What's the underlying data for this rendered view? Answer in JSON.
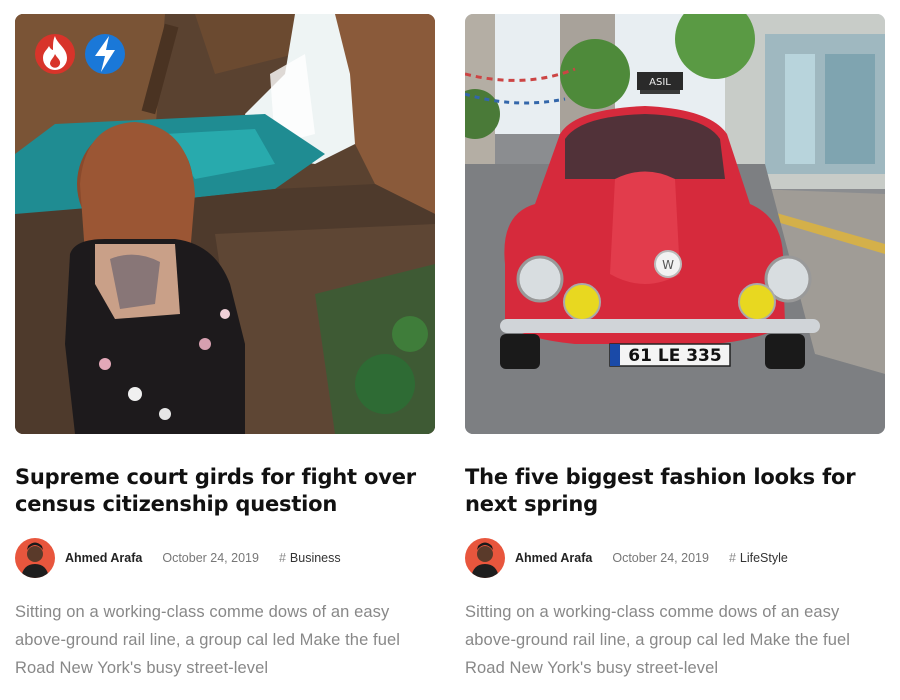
{
  "posts": [
    {
      "title": "Supreme court girds for fight over census citizenship question",
      "author": "Ahmed Arafa",
      "date": "October 24, 2019",
      "category": "Business",
      "excerpt": "Sitting on a working-class comme dows of an easy above-ground rail line, a group cal led Make the fuel Road New York's busy street-level",
      "badges": [
        "fire-icon",
        "lightning-icon"
      ]
    },
    {
      "title": "The five biggest fashion looks for next spring",
      "author": "Ahmed Arafa",
      "date": "October 24, 2019",
      "category": "LifeStyle",
      "excerpt": "Sitting on a working-class comme dows of an easy above-ground rail line, a group cal led Make the fuel Road New York's busy street-level",
      "image": {
        "plate": "61 LE 335",
        "shop_sign": "ASIL"
      }
    }
  ],
  "colors": {
    "hot_badge": "#d8342a",
    "trending_badge": "#1a78d8",
    "car": "#d62a3c"
  }
}
